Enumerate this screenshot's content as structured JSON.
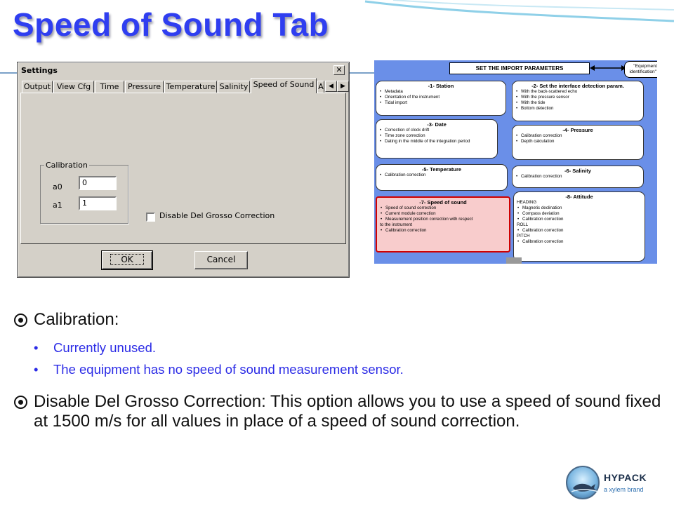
{
  "slide": {
    "title": "Speed of Sound Tab"
  },
  "dialog": {
    "title": "Settings",
    "close_label": "✕",
    "tabs": [
      "Output",
      "View Cfg",
      "Time",
      "Pressure",
      "Temperature",
      "Salinity",
      "Speed of Sound",
      "A"
    ],
    "active_tab": "Speed of Sound",
    "scroll_left": "◀",
    "scroll_right": "▶",
    "calibration": {
      "group_label": "Calibration",
      "a0_label": "a0",
      "a0_value": "0",
      "a1_label": "a1",
      "a1_value": "1"
    },
    "checkbox": {
      "label": "Disable Del Grosso Correction",
      "checked": false
    },
    "ok_label": "OK",
    "cancel_label": "Cancel"
  },
  "flowchart": {
    "header": "SET THE IMPORT PARAMETERS",
    "note": "\"Equipment identification\" fil",
    "boxes": [
      {
        "title": "-1- Station",
        "items": [
          {
            "text": "Metadata",
            "bullet": true
          },
          {
            "text": "Orientation of the instrument",
            "bullet": true
          },
          {
            "text": "Tidal import",
            "bullet": true
          }
        ]
      },
      {
        "title": "-2- Set the interface detection param.",
        "items": [
          {
            "text": "With the back-scattered echo",
            "bullet": true
          },
          {
            "text": "With the pressure sensor",
            "bullet": true
          },
          {
            "text": "With the tide",
            "bullet": true
          },
          {
            "text": "Bottom detection",
            "bullet": true
          }
        ]
      },
      {
        "title": "-3- Date",
        "items": [
          {
            "text": "Correction of clock drift",
            "bullet": true
          },
          {
            "text": "Time zone correction",
            "bullet": true
          },
          {
            "text": "Dating in the middle of the integration period",
            "bullet": true
          }
        ]
      },
      {
        "title": "-4- Pressure",
        "items": [
          {
            "text": "Calibration correction",
            "bullet": true
          },
          {
            "text": "Depth calculation",
            "bullet": true
          }
        ]
      },
      {
        "title": "-5- Temperature",
        "items": [
          {
            "text": "Calibration correction",
            "bullet": true
          }
        ]
      },
      {
        "title": "-6- Salinity",
        "items": [
          {
            "text": "Calibration correction",
            "bullet": true
          }
        ]
      },
      {
        "title": "-7- Speed of sound",
        "items": [
          {
            "text": "Speed of sound correction",
            "bullet": true
          },
          {
            "text": "Current module correction",
            "bullet": true
          },
          {
            "text": "Measurement position correction with respect",
            "bullet": true
          },
          {
            "text": "to the instrument",
            "bullet": false
          },
          {
            "text": "Calibration correction",
            "bullet": true
          }
        ]
      },
      {
        "title": "-8- Attitude",
        "items": [
          {
            "text": "HEADING",
            "bullet": false
          },
          {
            "text": "Magnetic declination",
            "bullet": true
          },
          {
            "text": "Compass deviation",
            "bullet": true
          },
          {
            "text": "Calibration correction",
            "bullet": true
          },
          {
            "text": "ROLL",
            "bullet": false
          },
          {
            "text": "Calibration correction",
            "bullet": true
          },
          {
            "text": "PITCH",
            "bullet": false
          },
          {
            "text": "Calibration correction",
            "bullet": true
          }
        ]
      }
    ],
    "highlight_color": "#d00000",
    "background_color": "#6a8fe8"
  },
  "bullets": {
    "calibration_heading": "Calibration:",
    "calibration_points": [
      "Currently unused.",
      "The equipment has no speed of sound measurement sensor."
    ],
    "disable_text": "Disable Del Grosso Correction: This option allows you to use a speed of sound fixed at 1500 m/s for all values in place of a speed of sound correction."
  },
  "logo": {
    "name": "HYPACK",
    "tagline": "a xylem brand"
  },
  "colors": {
    "title": "#2f3ef0",
    "sub_bullets": "#2b2be6"
  }
}
